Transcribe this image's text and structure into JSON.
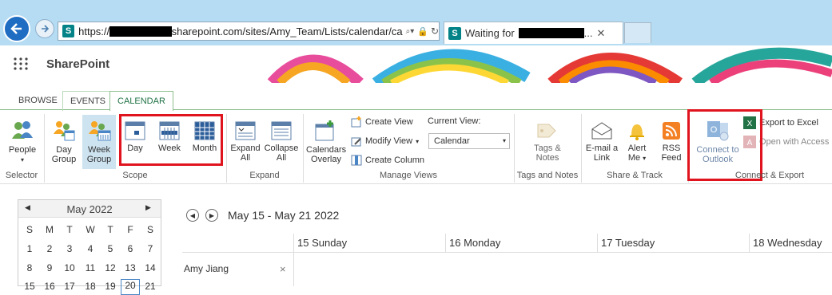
{
  "browser": {
    "url_prefix": "https://",
    "url_suffix": "sharepoint.com/sites/Amy_Team/Lists/calendar/ca",
    "tab_title": "Waiting for",
    "tab_suffix": "..."
  },
  "suite": {
    "brand": "SharePoint"
  },
  "ribbon_tabs": [
    "BROWSE",
    "EVENTS",
    "CALENDAR"
  ],
  "ribbon": {
    "selector": {
      "people": "People",
      "group_label": "Selector"
    },
    "scope": {
      "day_group": [
        "Day",
        "Group"
      ],
      "week_group": [
        "Week",
        "Group"
      ],
      "day": "Day",
      "week": "Week",
      "month": "Month",
      "group_label": "Scope"
    },
    "expand": {
      "expand_all": [
        "Expand",
        "All"
      ],
      "collapse_all": [
        "Collapse",
        "All"
      ],
      "group_label": "Expand"
    },
    "manage": {
      "calendars_overlay": [
        "Calendars",
        "Overlay"
      ],
      "create_view": "Create View",
      "modify_view": "Modify View",
      "create_column": "Create Column",
      "current_view_label": "Current View:",
      "current_view_value": "Calendar",
      "group_label": "Manage Views"
    },
    "tags": {
      "tags_notes": [
        "Tags &",
        "Notes"
      ],
      "group_label": "Tags and Notes"
    },
    "share": {
      "email_link": [
        "E-mail a",
        "Link"
      ],
      "alert_me": [
        "Alert",
        "Me"
      ],
      "rss_feed": [
        "RSS",
        "Feed"
      ],
      "group_label": "Share & Track"
    },
    "connect": {
      "connect_outlook": [
        "Connect to",
        "Outlook"
      ],
      "export_excel": "Export to Excel",
      "open_access": "Open with Access",
      "group_label": "Connect & Export"
    }
  },
  "mini_calendar": {
    "month": "May 2022",
    "weekdays": [
      "S",
      "M",
      "T",
      "W",
      "T",
      "F",
      "S"
    ],
    "weeks": [
      [
        "1",
        "2",
        "3",
        "4",
        "5",
        "6",
        "7"
      ],
      [
        "8",
        "9",
        "10",
        "11",
        "12",
        "13",
        "14"
      ],
      [
        "15",
        "16",
        "17",
        "18",
        "19",
        "20",
        "21"
      ]
    ],
    "today": "20"
  },
  "calendar": {
    "range": "May 15 - May 21 2022",
    "days": [
      "15 Sunday",
      "16 Monday",
      "17 Tuesday",
      "18 Wednesday"
    ],
    "person": "Amy Jiang",
    "remove": "×"
  },
  "colors": {
    "accent": "#217346",
    "highlight": "#e0141e",
    "browser_bg": "#b5dcf2"
  }
}
